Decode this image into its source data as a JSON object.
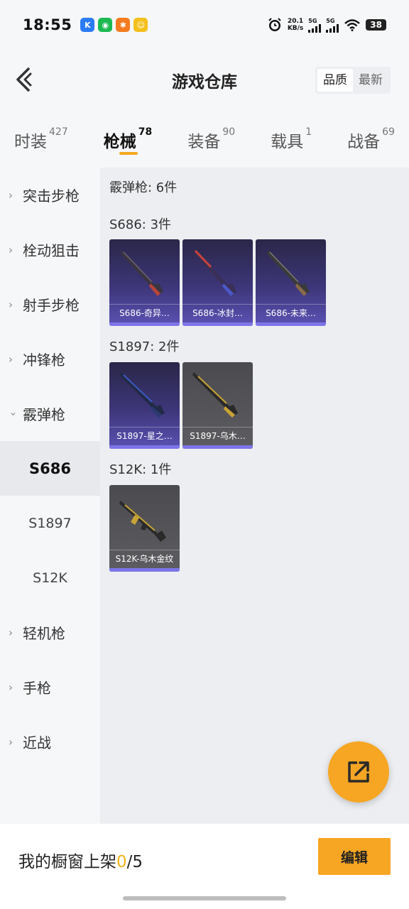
{
  "status_bar": {
    "time": "18:55",
    "net_speed_value": "20.1",
    "net_speed_unit": "KB/s",
    "sim1": "5G",
    "sim2": "5G",
    "battery": "38",
    "apps": [
      {
        "icon": "k-app-icon",
        "label": "K",
        "color": "#2a7bf4"
      },
      {
        "icon": "wechat-icon",
        "label": "◉",
        "color": "#1cb952"
      },
      {
        "icon": "orange-app-icon",
        "label": "✱",
        "color": "#f47b20"
      },
      {
        "icon": "yellow-app-icon",
        "label": "☺",
        "color": "#f4c01c"
      }
    ]
  },
  "header": {
    "title": "游戏仓库",
    "sort_options": [
      "品质",
      "最新"
    ],
    "sort_selected": "品质"
  },
  "categories": [
    {
      "name": "时装",
      "count": "427"
    },
    {
      "name": "枪械",
      "count": "78",
      "active": true
    },
    {
      "name": "装备",
      "count": "90"
    },
    {
      "name": "载具",
      "count": "1"
    },
    {
      "name": "战备",
      "count": "69"
    }
  ],
  "sidebar": {
    "items": [
      {
        "label": "突击步枪",
        "type": "category",
        "expanded": false
      },
      {
        "label": "栓动狙击",
        "type": "category",
        "expanded": false
      },
      {
        "label": "射手步枪",
        "type": "category",
        "expanded": false
      },
      {
        "label": "冲锋枪",
        "type": "category",
        "expanded": false
      },
      {
        "label": "霰弹枪",
        "type": "category",
        "expanded": true
      },
      {
        "label": "S686",
        "type": "sub",
        "active": true
      },
      {
        "label": "S1897",
        "type": "sub"
      },
      {
        "label": "S12K",
        "type": "sub"
      },
      {
        "label": "轻机枪",
        "type": "category",
        "expanded": false
      },
      {
        "label": "手枪",
        "type": "category",
        "expanded": false
      },
      {
        "label": "近战",
        "type": "category",
        "expanded": false
      }
    ]
  },
  "content": {
    "summary": "霰弹枪: 6件",
    "groups": [
      {
        "title": "S686: 3件",
        "items": [
          {
            "name": "S686-奇异…",
            "rarity": "purple",
            "accent": "#b8433a"
          },
          {
            "name": "S686-冰封…",
            "rarity": "purple",
            "accent": "#c9443a"
          },
          {
            "name": "S686-未来…",
            "rarity": "purple",
            "accent": "#8a6a4a"
          }
        ]
      },
      {
        "title": "S1897: 2件",
        "items": [
          {
            "name": "S1897-星之…",
            "rarity": "purple",
            "accent": "#3a5ac0"
          },
          {
            "name": "S1897-乌木…",
            "rarity": "gray",
            "accent": "#c8a437"
          }
        ]
      },
      {
        "title": "S12K: 1件",
        "items": [
          {
            "name": "S12K-乌木金纹",
            "rarity": "gray",
            "accent": "#c8a437"
          }
        ]
      }
    ]
  },
  "footer": {
    "label": "我的橱窗上架",
    "count_current": "0",
    "count_total": "/5",
    "edit_label": "编辑"
  },
  "fab": {
    "icon": "share-export-icon"
  }
}
